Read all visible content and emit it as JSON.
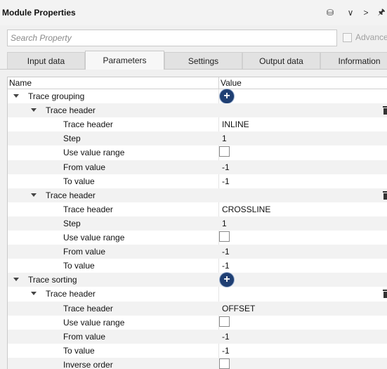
{
  "window": {
    "title": "Module Properties",
    "icons": [
      "database-icon",
      "chevron-down-icon",
      "chevron-right-icon",
      "pin-icon"
    ],
    "glyphs": {
      "database": "⛁",
      "chevron_down": "∨",
      "chevron_right": ">",
      "pin": "🖈"
    }
  },
  "search": {
    "placeholder": "Search Property",
    "value": ""
  },
  "advanced": {
    "label": "Advanced",
    "checked": false
  },
  "tabs": [
    {
      "label": "Input data",
      "active": false
    },
    {
      "label": "Parameters",
      "active": true
    },
    {
      "label": "Settings",
      "active": false
    },
    {
      "label": "Output data",
      "active": false
    },
    {
      "label": "Information",
      "active": false
    }
  ],
  "table": {
    "col_name": "Name",
    "col_value": "Value",
    "plus_glyph": "+",
    "rows": [
      {
        "name": "Trace grouping",
        "level": 0,
        "expandable": true,
        "value_type": "add"
      },
      {
        "name": "Trace header",
        "level": 1,
        "expandable": true,
        "value_type": "trash"
      },
      {
        "name": "Trace header",
        "level": 2,
        "value_type": "text",
        "value": "INLINE"
      },
      {
        "name": "Step",
        "level": 2,
        "value_type": "text",
        "value": "1"
      },
      {
        "name": "Use value range",
        "level": 2,
        "value_type": "checkbox",
        "checked": false
      },
      {
        "name": "From value",
        "level": 2,
        "value_type": "text",
        "value": "-1"
      },
      {
        "name": "To value",
        "level": 2,
        "value_type": "text",
        "value": "-1"
      },
      {
        "name": "Trace header",
        "level": 1,
        "expandable": true,
        "value_type": "trash"
      },
      {
        "name": "Trace header",
        "level": 2,
        "value_type": "text",
        "value": "CROSSLINE"
      },
      {
        "name": "Step",
        "level": 2,
        "value_type": "text",
        "value": "1"
      },
      {
        "name": "Use value range",
        "level": 2,
        "value_type": "checkbox",
        "checked": false
      },
      {
        "name": "From value",
        "level": 2,
        "value_type": "text",
        "value": "-1"
      },
      {
        "name": "To value",
        "level": 2,
        "value_type": "text",
        "value": "-1"
      },
      {
        "name": "Trace sorting",
        "level": 0,
        "expandable": true,
        "value_type": "add"
      },
      {
        "name": "Trace header",
        "level": 1,
        "expandable": true,
        "value_type": "trash"
      },
      {
        "name": "Trace header",
        "level": 2,
        "value_type": "text",
        "value": "OFFSET"
      },
      {
        "name": "Use value range",
        "level": 2,
        "value_type": "checkbox",
        "checked": false
      },
      {
        "name": "From value",
        "level": 2,
        "value_type": "text",
        "value": "-1"
      },
      {
        "name": "To value",
        "level": 2,
        "value_type": "text",
        "value": "-1"
      },
      {
        "name": "Inverse order",
        "level": 2,
        "value_type": "checkbox",
        "checked": false
      }
    ]
  }
}
